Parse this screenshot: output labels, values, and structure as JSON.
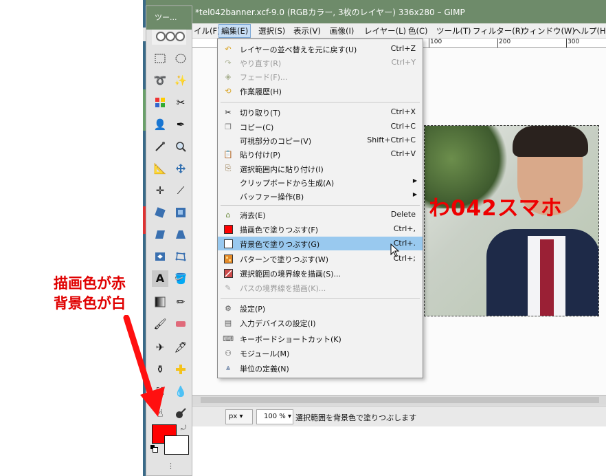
{
  "window": {
    "title": "*tel042banner.xcf-9.0 (RGBカラー, 3枚のレイヤー) 336x280 – GIMP"
  },
  "toolbox": {
    "title": "ツー..."
  },
  "menubar": {
    "items": [
      {
        "label": "イル(F)"
      },
      {
        "label": "編集(E)"
      },
      {
        "label": "選択(S)"
      },
      {
        "label": "表示(V)"
      },
      {
        "label": "画像(I)"
      },
      {
        "label": "レイヤー(L)"
      },
      {
        "label": "色(C)"
      },
      {
        "label": "ツール(T)"
      },
      {
        "label": "フィルター(R)"
      },
      {
        "label": "ウィンドウ(W)"
      },
      {
        "label": "ヘルプ(H)"
      }
    ]
  },
  "ruler": {
    "labels": [
      "100",
      "200",
      "300"
    ]
  },
  "edit_menu": {
    "items": [
      {
        "label": "レイヤーの並べ替えを元に戻す(U)",
        "shortcut": "Ctrl+Z",
        "icon": "undo-icon",
        "disabled": false
      },
      {
        "label": "やり直す(R)",
        "shortcut": "Ctrl+Y",
        "icon": "redo-icon",
        "disabled": true
      },
      {
        "label": "フェード(F)...",
        "shortcut": "",
        "icon": "fade-icon",
        "disabled": true
      },
      {
        "label": "作業履歴(H)",
        "shortcut": "",
        "icon": "history-icon",
        "disabled": false
      },
      {
        "label": "切り取り(T)",
        "shortcut": "Ctrl+X",
        "icon": "scissors-icon",
        "disabled": false
      },
      {
        "label": "コピー(C)",
        "shortcut": "Ctrl+C",
        "icon": "copy-icon",
        "disabled": false
      },
      {
        "label": "可視部分のコピー(V)",
        "shortcut": "Shift+Ctrl+C",
        "icon": "",
        "disabled": false
      },
      {
        "label": "貼り付け(P)",
        "shortcut": "Ctrl+V",
        "icon": "paste-icon",
        "disabled": false
      },
      {
        "label": "選択範囲内に貼り付け(I)",
        "shortcut": "",
        "icon": "paste-into-icon",
        "disabled": false
      },
      {
        "label": "クリップボードから生成(A)",
        "shortcut": "",
        "icon": "",
        "disabled": false,
        "submenu": true
      },
      {
        "label": "バッファー操作(B)",
        "shortcut": "",
        "icon": "",
        "disabled": false,
        "submenu": true
      },
      {
        "label": "消去(E)",
        "shortcut": "Delete",
        "icon": "clear-icon",
        "disabled": false
      },
      {
        "label": "描画色で塗りつぶす(F)",
        "shortcut": "Ctrl+,",
        "icon": "fg-fill-icon",
        "disabled": false
      },
      {
        "label": "背景色で塗りつぶす(G)",
        "shortcut": "Ctrl+.",
        "icon": "bg-fill-icon",
        "disabled": false,
        "highlighted": true
      },
      {
        "label": "パターンで塗りつぶす(W)",
        "shortcut": "Ctrl+;",
        "icon": "pattern-fill-icon",
        "disabled": false
      },
      {
        "label": "選択範囲の境界線を描画(S)...",
        "shortcut": "",
        "icon": "stroke-selection-icon",
        "disabled": false
      },
      {
        "label": "パスの境界線を描画(K)...",
        "shortcut": "",
        "icon": "stroke-path-icon",
        "disabled": true
      },
      {
        "label": "設定(P)",
        "shortcut": "",
        "icon": "preferences-icon",
        "disabled": false
      },
      {
        "label": "入力デバイスの設定(I)",
        "shortcut": "",
        "icon": "input-devices-icon",
        "disabled": false
      },
      {
        "label": "キーボードショートカット(K)",
        "shortcut": "",
        "icon": "keyboard-icon",
        "disabled": false
      },
      {
        "label": "モジュール(M)",
        "shortcut": "",
        "icon": "modules-icon",
        "disabled": false
      },
      {
        "label": "単位の定義(N)",
        "shortcut": "",
        "icon": "units-icon",
        "disabled": false
      }
    ]
  },
  "image": {
    "overlay_text": "わ042スマホ"
  },
  "statusbar": {
    "unit": "px",
    "zoom": "100 %",
    "message": "選択範囲を背景色で塗りつぶします"
  },
  "annotation": {
    "line1": "描画色が赤",
    "line2": "背景色が白"
  },
  "colors": {
    "foreground": "#ff0000",
    "background": "#ffffff",
    "titlebar": "#6e8b6a",
    "highlight": "#99c9ef",
    "annotation": "#e00000"
  }
}
